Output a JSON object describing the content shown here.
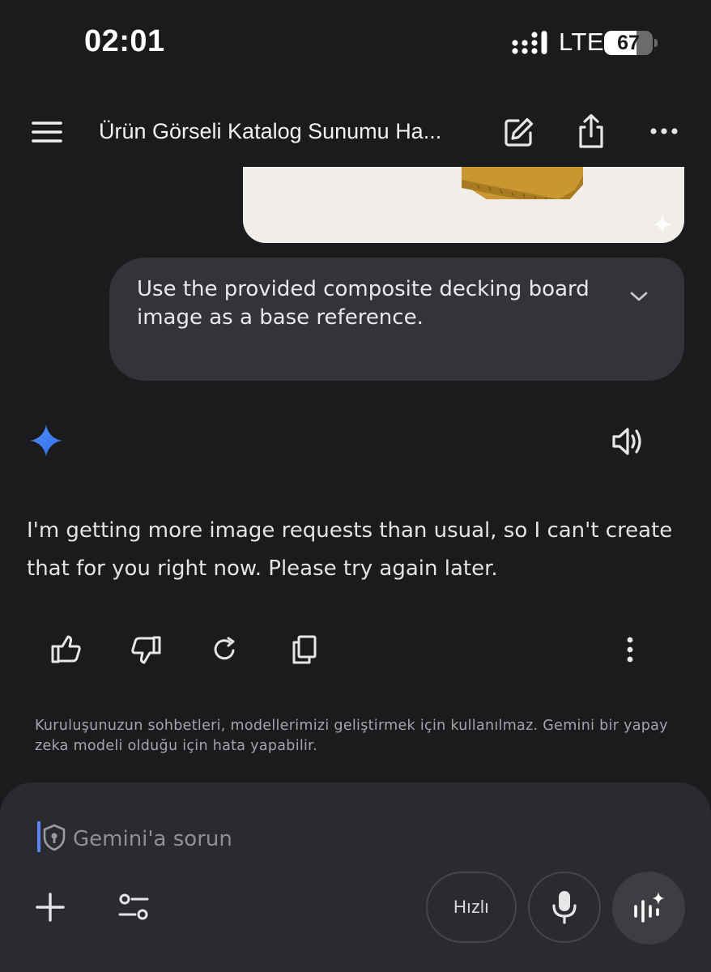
{
  "status_bar": {
    "time": "02:01",
    "network": "LTE",
    "battery_level": "67",
    "battery_fraction": 0.67
  },
  "header": {
    "title": "Ürün Görseli Katalog Sunumu Ha...",
    "icons": {
      "menu": "menu-icon",
      "edit": "edit-icon",
      "share": "share-icon",
      "more": "more-horizontal-icon"
    }
  },
  "conversation": {
    "user_prompt": "Use the provided composite decking board image as a base reference.",
    "response": "I'm getting more image requests than usual, so I can't create that for you right now. Please try again later.",
    "actions": [
      "thumbs-up-icon",
      "thumbs-down-icon",
      "redo-icon",
      "copy-icon",
      "more-vertical-icon"
    ]
  },
  "disclaimer": "Kuruluşunuzun sohbetleri, modellerimizi geliştirmek için kullanılmaz. Gemini bir yapay zeka modeli olduğu için hata yapabilir.",
  "composer": {
    "placeholder": "Gemini'a sorun",
    "mode_label": "Hızlı"
  },
  "colors": {
    "background": "#1b1b1d",
    "bubble": "#333437",
    "composer": "#2a2b2e",
    "accent_blue": "#4f8ff7",
    "cursor": "#5b86f5"
  }
}
